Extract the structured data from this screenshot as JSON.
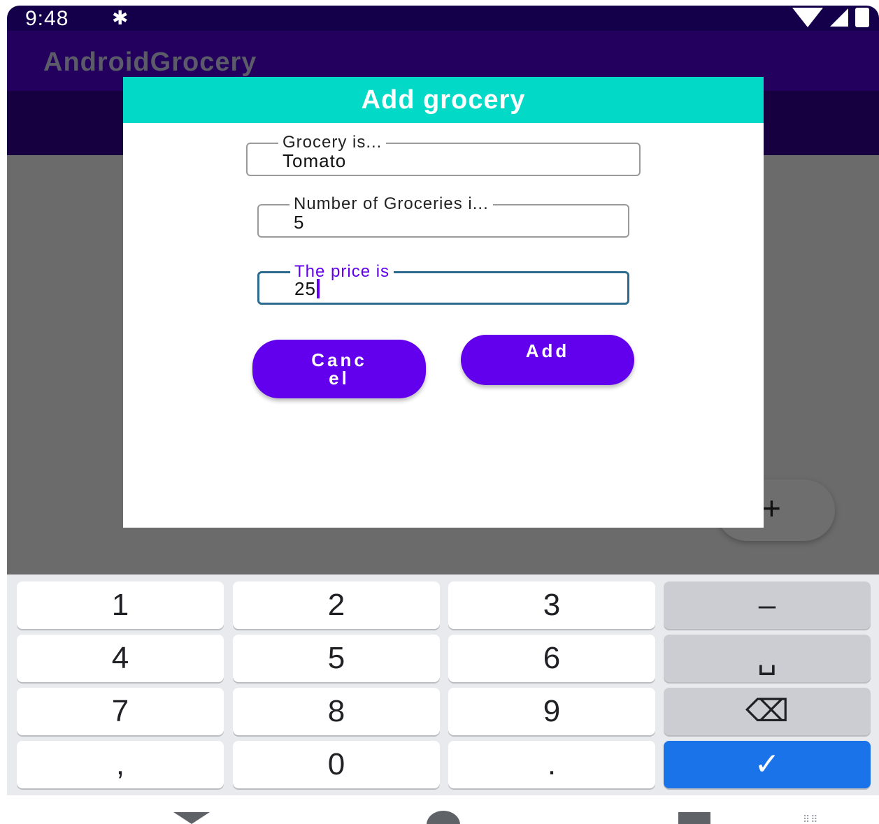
{
  "status_bar": {
    "time": "9:48",
    "icons": [
      "gear-icon",
      "wifi-icon",
      "signal-icon",
      "battery-icon"
    ]
  },
  "app_bar": {
    "title": "AndroidGrocery"
  },
  "fab": {
    "label": "+"
  },
  "dialog": {
    "title": "Add grocery",
    "fields": [
      {
        "label": "Grocery is...",
        "value": "Tomato"
      },
      {
        "label": "Number of Groceries i...",
        "value": "5"
      },
      {
        "label": "The price is",
        "value": "25"
      }
    ],
    "cancel_label": "Canc el",
    "cancel_line1": "Canc",
    "cancel_line2": "el",
    "add_label": "Add"
  },
  "keyboard": {
    "rows": [
      [
        "1",
        "2",
        "3",
        "–"
      ],
      [
        "4",
        "5",
        "6",
        "␣"
      ],
      [
        "7",
        "8",
        "9",
        "⌫"
      ],
      [
        ",",
        "0",
        ".",
        "✓"
      ]
    ]
  },
  "nav": {
    "keyboard_hint": "⠿⠿"
  },
  "colors": {
    "accent": "#6200ee",
    "header": "#03d9c7",
    "app_bar": "#23005d",
    "enter": "#1a73e8"
  }
}
